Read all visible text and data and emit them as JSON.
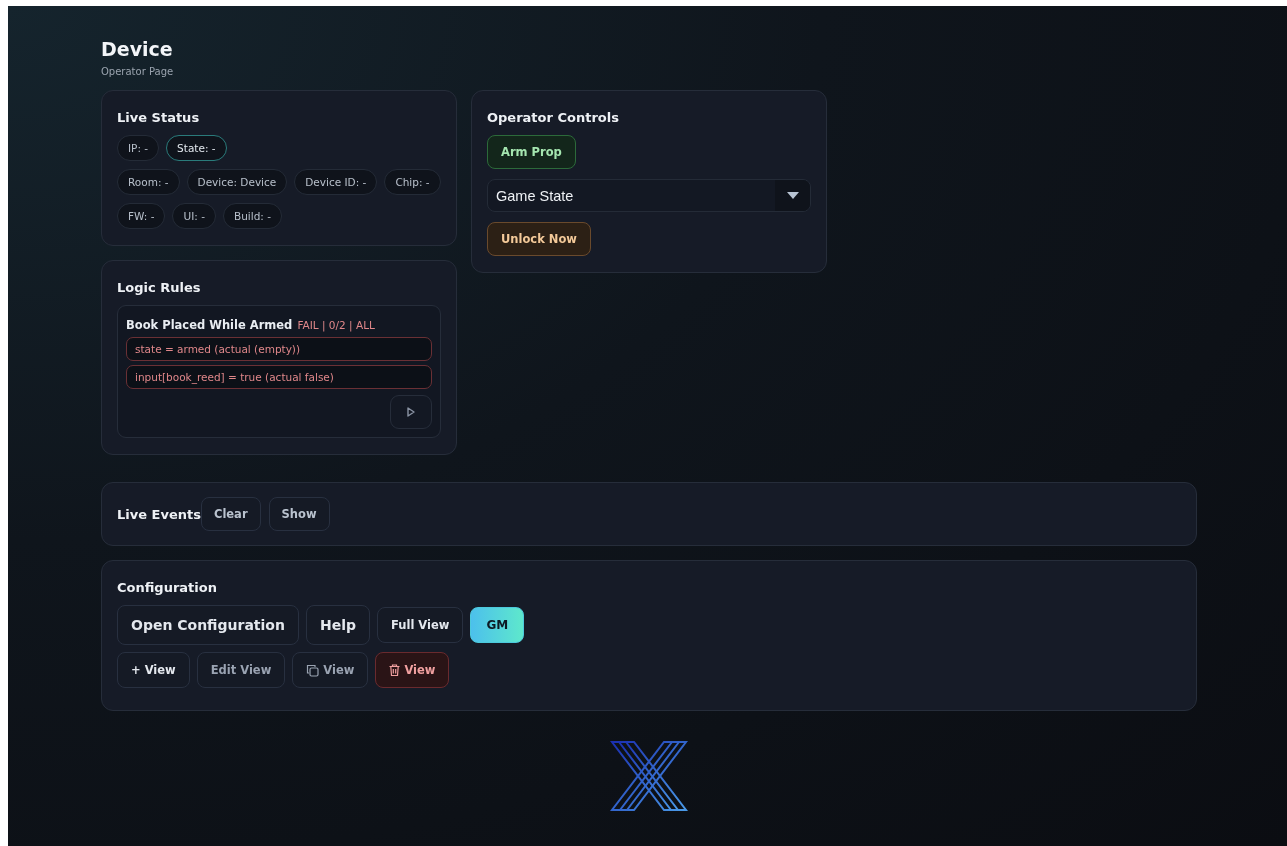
{
  "header": {
    "title": "Device",
    "subtitle": "Operator Page"
  },
  "live_status": {
    "title": "Live Status",
    "chip_rows": [
      [
        {
          "label": "IP: -",
          "selected": false
        },
        {
          "label": "State: -",
          "selected": true
        }
      ],
      [
        {
          "label": "Room: -",
          "selected": false
        },
        {
          "label": "Device: Device",
          "selected": false
        },
        {
          "label": "Device ID: -",
          "selected": false
        },
        {
          "label": "Chip: -",
          "selected": false
        }
      ],
      [
        {
          "label": "FW: -",
          "selected": false
        },
        {
          "label": "UI: -",
          "selected": false
        },
        {
          "label": "Build: -",
          "selected": false
        }
      ]
    ]
  },
  "operator_controls": {
    "title": "Operator Controls",
    "items": [
      {
        "kind": "success",
        "label": "Arm Prop"
      },
      {
        "kind": "select",
        "value": "Game State"
      },
      {
        "kind": "warning",
        "label": "Unlock Now"
      }
    ]
  },
  "logic_rules": {
    "title": "Logic Rules",
    "rules": [
      {
        "name": "Book Placed While Armed",
        "status": "FAIL | 0/2 | ALL",
        "passed": false,
        "conditions": [
          {
            "text": "state = armed (actual (empty))",
            "passed": false
          },
          {
            "text": "input[book_reed] = true (actual false)",
            "passed": false
          }
        ]
      }
    ]
  },
  "live_events": {
    "title": "Live Events",
    "buttons": [
      "Clear",
      "Show"
    ]
  },
  "configuration": {
    "title": "Configuration",
    "button_rows": [
      [
        {
          "kind": "large",
          "label": "Open Configuration"
        },
        {
          "kind": "large",
          "label": "Help"
        },
        {
          "kind": "small",
          "label": "Full View"
        },
        {
          "kind": "accent",
          "label": "GM"
        }
      ],
      [
        {
          "kind": "small",
          "label": "+ View"
        },
        {
          "kind": "muted",
          "label": "Edit View"
        },
        {
          "kind": "duplicate",
          "label": "View"
        },
        {
          "kind": "delete",
          "label": "View"
        }
      ]
    ]
  }
}
